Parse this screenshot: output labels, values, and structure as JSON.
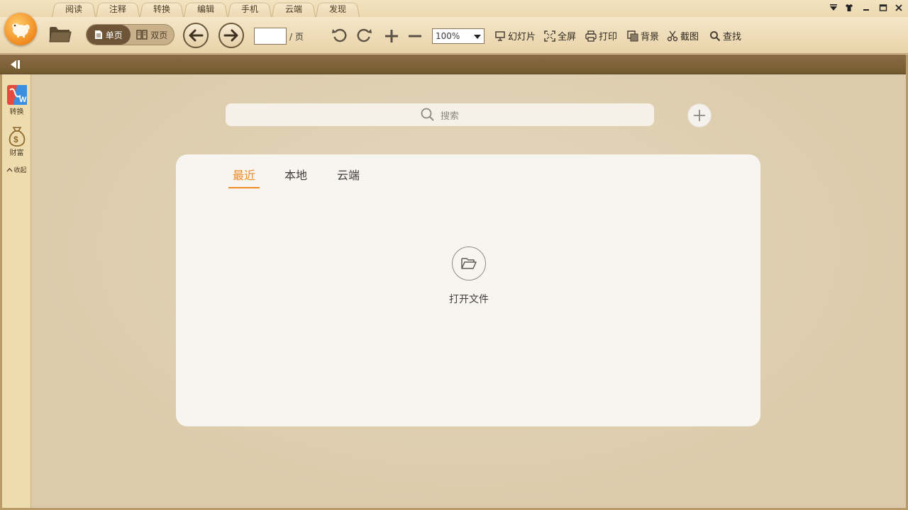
{
  "menu_tabs": [
    "阅读",
    "注释",
    "转换",
    "编辑",
    "手机",
    "云端",
    "发现"
  ],
  "toolbar": {
    "single_page": "单页",
    "double_page": "双页",
    "page_value": "",
    "page_suffix": "/ 页",
    "zoom": "100%",
    "slideshow": "幻灯片",
    "fullscreen": "全屏",
    "print": "打印",
    "background": "背景",
    "screenshot": "截图",
    "find": "查找"
  },
  "sidebar": {
    "convert": "转换",
    "wealth": "财富",
    "collapse": "收起"
  },
  "search": {
    "placeholder": "搜索"
  },
  "panel": {
    "tabs": [
      "最近",
      "本地",
      "云端"
    ],
    "active_tab": "最近",
    "open_file": "打开文件"
  },
  "colors": {
    "accent": "#f08a24",
    "toolbar_bg": "#f4e6c8",
    "subbar_bg": "#8b6d45",
    "main_bg": "#dccbab",
    "panel_bg": "#f8f4ef"
  }
}
